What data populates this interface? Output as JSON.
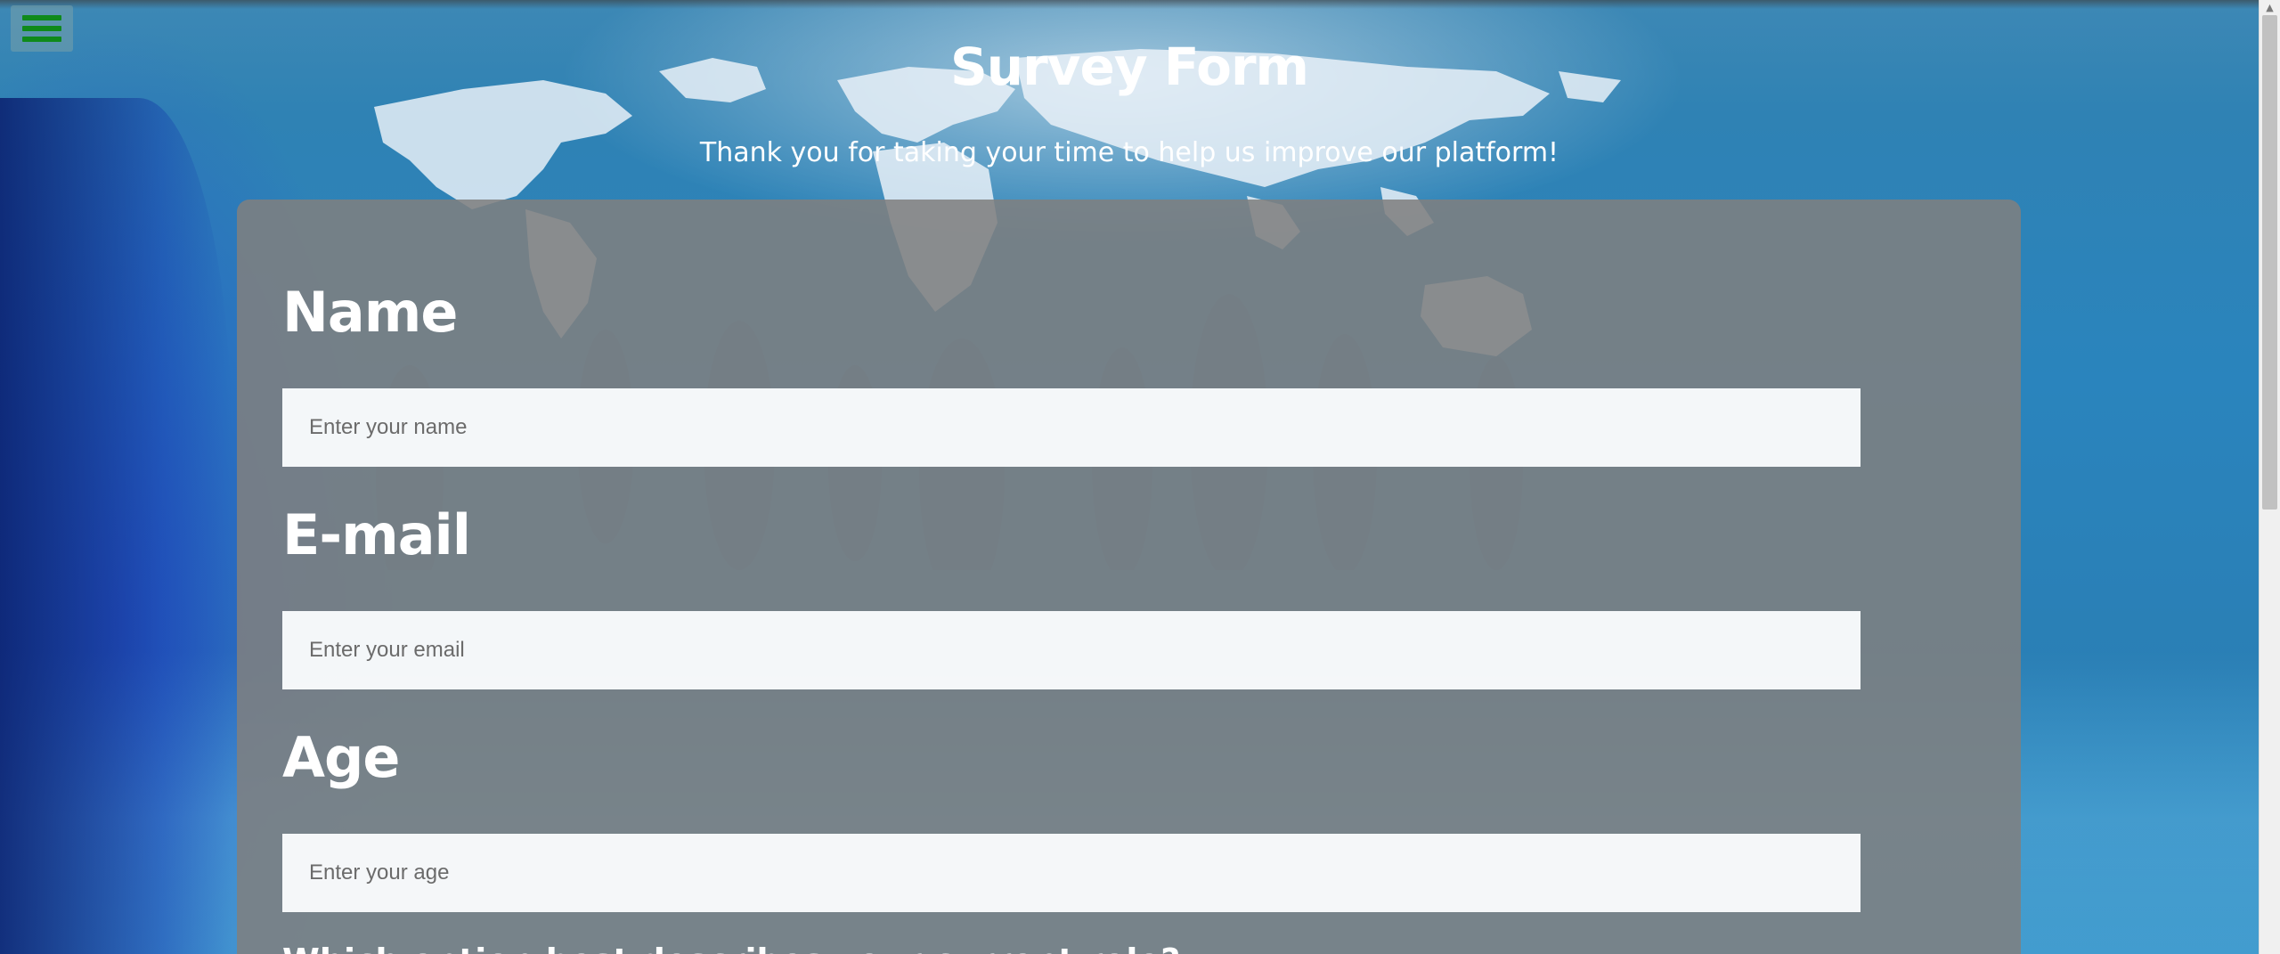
{
  "page": {
    "title": "Survey Form",
    "description": "Thank you for taking your time to help us improve our platform!"
  },
  "nav": {
    "menu_icon": "hamburger-menu-icon",
    "menu_icon_color": "#0f8a1b"
  },
  "form": {
    "fields": [
      {
        "label": "Name",
        "placeholder": "Enter your name",
        "value": ""
      },
      {
        "label": "E-mail",
        "placeholder": "Enter your email",
        "value": ""
      },
      {
        "label": "Age",
        "placeholder": "Enter your age",
        "value": ""
      }
    ],
    "next_question": "Which option best describes your current role?"
  },
  "colors": {
    "card_background": "#808080",
    "text": "#ffffff",
    "input_background": "#fafcfe",
    "background_blue": "#2a84bd"
  }
}
